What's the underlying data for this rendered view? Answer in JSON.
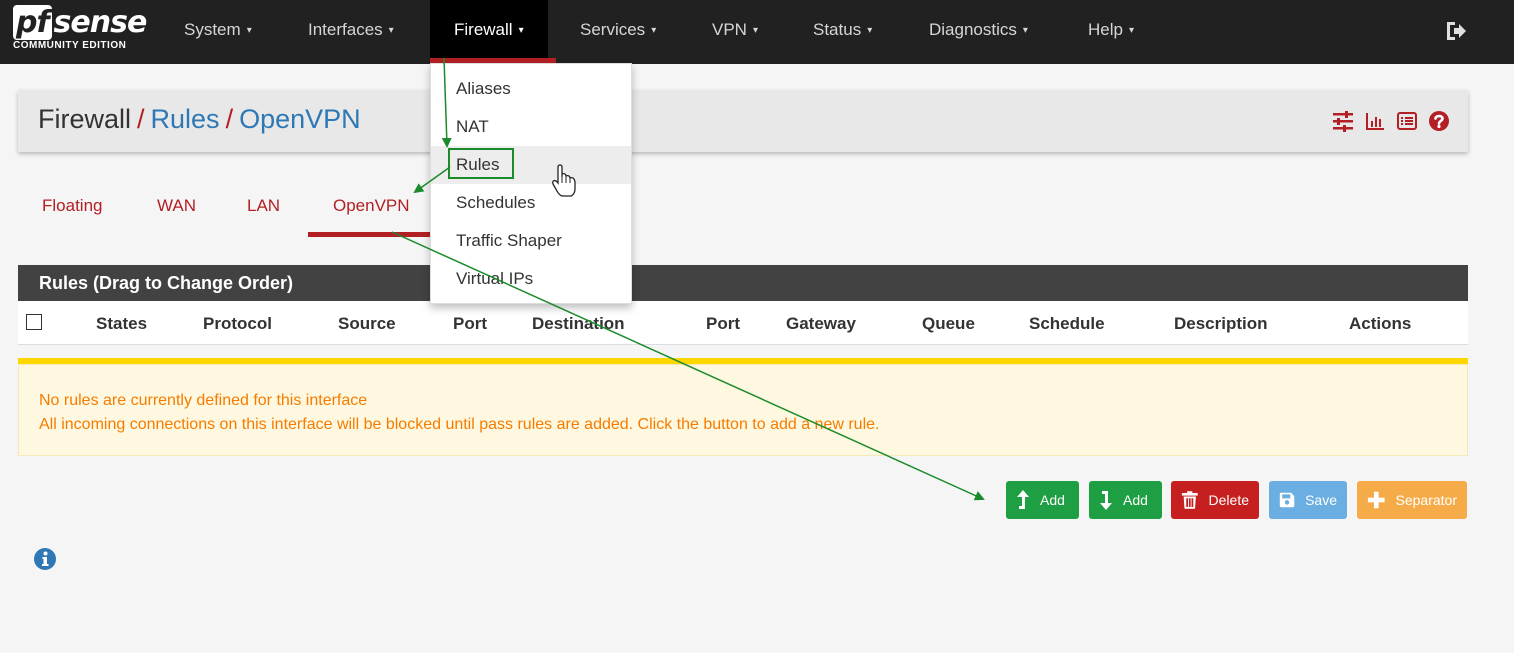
{
  "brand": {
    "logo_text": "sense",
    "logo_prefix": "pf",
    "edition": "COMMUNITY EDITION"
  },
  "nav": {
    "items": [
      {
        "label": "System"
      },
      {
        "label": "Interfaces"
      },
      {
        "label": "Firewall"
      },
      {
        "label": "Services"
      },
      {
        "label": "VPN"
      },
      {
        "label": "Status"
      },
      {
        "label": "Diagnostics"
      },
      {
        "label": "Help"
      }
    ],
    "caret": "▾",
    "active": "Firewall"
  },
  "breadcrumb": {
    "root": "Firewall",
    "sep": "/",
    "level2": "Rules",
    "level3": "OpenVPN"
  },
  "breadcrumb_icons": [
    "sliders-icon",
    "chart-icon",
    "list-icon",
    "help-icon"
  ],
  "tabs": [
    {
      "label": "Floating"
    },
    {
      "label": "WAN"
    },
    {
      "label": "LAN"
    },
    {
      "label": "OpenVPN"
    }
  ],
  "active_tab": "OpenVPN",
  "table": {
    "title": "Rules (Drag to Change Order)",
    "columns": [
      "States",
      "Protocol",
      "Source",
      "Port",
      "Destination",
      "Port",
      "Gateway",
      "Queue",
      "Schedule",
      "Description",
      "Actions"
    ]
  },
  "alert": {
    "line1": "No rules are currently defined for this interface",
    "line2": "All incoming connections on this interface will be blocked until pass rules are added. Click the button to add a new rule."
  },
  "buttons": {
    "add_top": "Add",
    "add_bottom": "Add",
    "delete": "Delete",
    "save": "Save",
    "separator": "Separator"
  },
  "dropdown": {
    "items": [
      {
        "label": "Aliases"
      },
      {
        "label": "NAT"
      },
      {
        "label": "Rules"
      },
      {
        "label": "Schedules"
      },
      {
        "label": "Traffic Shaper"
      },
      {
        "label": "Virtual IPs"
      }
    ],
    "hovered": "Rules"
  },
  "colors": {
    "accent_red": "#b21f24",
    "link_blue": "#2e78b5",
    "nav_bg": "#212121",
    "annotation_green": "#1a8a2a"
  }
}
